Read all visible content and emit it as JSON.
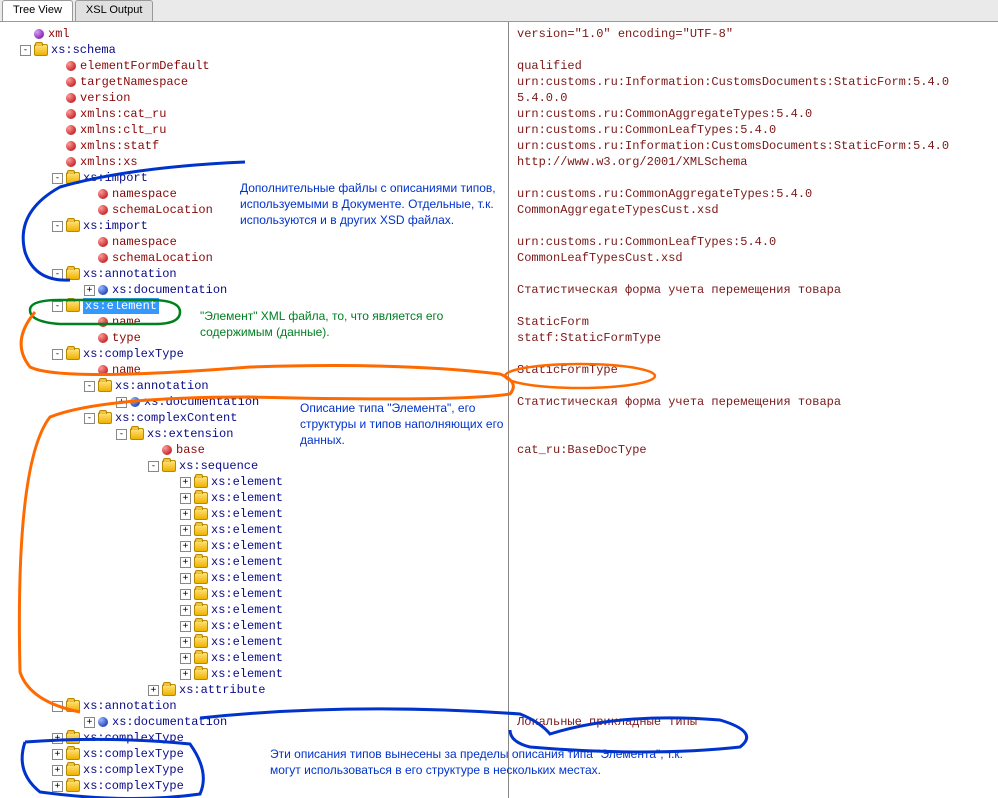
{
  "tabs": {
    "tree_view": "Tree View",
    "xsl_output": "XSL Output"
  },
  "tree": [
    {
      "depth": 0,
      "exp": "",
      "icon": "ball-p",
      "label": "xml",
      "cls": "lbl-red",
      "val": "version=\"1.0\" encoding=\"UTF-8\""
    },
    {
      "depth": 0,
      "exp": "-",
      "icon": "folder",
      "label": "xs:schema",
      "cls": "lbl",
      "val": ""
    },
    {
      "depth": 1,
      "exp": "",
      "icon": "ball-r",
      "label": "elementFormDefault",
      "cls": "lbl-red",
      "val": "qualified"
    },
    {
      "depth": 1,
      "exp": "",
      "icon": "ball-r",
      "label": "targetNamespace",
      "cls": "lbl-red",
      "val": "urn:customs.ru:Information:CustomsDocuments:StaticForm:5.4.0"
    },
    {
      "depth": 1,
      "exp": "",
      "icon": "ball-r",
      "label": "version",
      "cls": "lbl-red",
      "val": "5.4.0.0"
    },
    {
      "depth": 1,
      "exp": "",
      "icon": "ball-r",
      "label": "xmlns:cat_ru",
      "cls": "lbl-red",
      "val": "urn:customs.ru:CommonAggregateTypes:5.4.0"
    },
    {
      "depth": 1,
      "exp": "",
      "icon": "ball-r",
      "label": "xmlns:clt_ru",
      "cls": "lbl-red",
      "val": "urn:customs.ru:CommonLeafTypes:5.4.0"
    },
    {
      "depth": 1,
      "exp": "",
      "icon": "ball-r",
      "label": "xmlns:statf",
      "cls": "lbl-red",
      "val": "urn:customs.ru:Information:CustomsDocuments:StaticForm:5.4.0"
    },
    {
      "depth": 1,
      "exp": "",
      "icon": "ball-r",
      "label": "xmlns:xs",
      "cls": "lbl-red",
      "val": "http://www.w3.org/2001/XMLSchema"
    },
    {
      "depth": 1,
      "exp": "-",
      "icon": "folder",
      "label": "xs:import",
      "cls": "lbl",
      "val": ""
    },
    {
      "depth": 2,
      "exp": "",
      "icon": "ball-r",
      "label": "namespace",
      "cls": "lbl-red",
      "val": "urn:customs.ru:CommonAggregateTypes:5.4.0"
    },
    {
      "depth": 2,
      "exp": "",
      "icon": "ball-r",
      "label": "schemaLocation",
      "cls": "lbl-red",
      "val": "CommonAggregateTypesCust.xsd"
    },
    {
      "depth": 1,
      "exp": "-",
      "icon": "folder",
      "label": "xs:import",
      "cls": "lbl",
      "val": ""
    },
    {
      "depth": 2,
      "exp": "",
      "icon": "ball-r",
      "label": "namespace",
      "cls": "lbl-red",
      "val": "urn:customs.ru:CommonLeafTypes:5.4.0"
    },
    {
      "depth": 2,
      "exp": "",
      "icon": "ball-r",
      "label": "schemaLocation",
      "cls": "lbl-red",
      "val": "CommonLeafTypesCust.xsd"
    },
    {
      "depth": 1,
      "exp": "-",
      "icon": "folder",
      "label": "xs:annotation",
      "cls": "lbl",
      "val": ""
    },
    {
      "depth": 2,
      "exp": "+",
      "icon": "ball-b",
      "label": "xs:documentation",
      "cls": "lbl",
      "val": "Статистическая форма учета перемещения товара"
    },
    {
      "depth": 1,
      "exp": "-",
      "icon": "folder",
      "label": "xs:element",
      "cls": "lbl",
      "val": "",
      "selected": true
    },
    {
      "depth": 2,
      "exp": "",
      "icon": "ball-r",
      "label": "name",
      "cls": "lbl-red",
      "val": "StaticForm"
    },
    {
      "depth": 2,
      "exp": "",
      "icon": "ball-r",
      "label": "type",
      "cls": "lbl-red",
      "val": "statf:StaticFormType"
    },
    {
      "depth": 1,
      "exp": "-",
      "icon": "folder",
      "label": "xs:complexType",
      "cls": "lbl",
      "val": ""
    },
    {
      "depth": 2,
      "exp": "",
      "icon": "ball-r",
      "label": "name",
      "cls": "lbl-red",
      "val": "StaticFormType"
    },
    {
      "depth": 2,
      "exp": "-",
      "icon": "folder",
      "label": "xs:annotation",
      "cls": "lbl",
      "val": ""
    },
    {
      "depth": 3,
      "exp": "+",
      "icon": "ball-b",
      "label": "xs:documentation",
      "cls": "lbl",
      "val": "Статистическая форма учета перемещения товара"
    },
    {
      "depth": 2,
      "exp": "-",
      "icon": "folder",
      "label": "xs:complexContent",
      "cls": "lbl",
      "val": ""
    },
    {
      "depth": 3,
      "exp": "-",
      "icon": "folder",
      "label": "xs:extension",
      "cls": "lbl",
      "val": ""
    },
    {
      "depth": 4,
      "exp": "",
      "icon": "ball-r",
      "label": "base",
      "cls": "lbl-red",
      "val": "cat_ru:BaseDocType"
    },
    {
      "depth": 4,
      "exp": "-",
      "icon": "folder",
      "label": "xs:sequence",
      "cls": "lbl",
      "val": ""
    },
    {
      "depth": 5,
      "exp": "+",
      "icon": "folder",
      "label": "xs:element",
      "cls": "lbl",
      "val": ""
    },
    {
      "depth": 5,
      "exp": "+",
      "icon": "folder",
      "label": "xs:element",
      "cls": "lbl",
      "val": ""
    },
    {
      "depth": 5,
      "exp": "+",
      "icon": "folder",
      "label": "xs:element",
      "cls": "lbl",
      "val": ""
    },
    {
      "depth": 5,
      "exp": "+",
      "icon": "folder",
      "label": "xs:element",
      "cls": "lbl",
      "val": ""
    },
    {
      "depth": 5,
      "exp": "+",
      "icon": "folder",
      "label": "xs:element",
      "cls": "lbl",
      "val": ""
    },
    {
      "depth": 5,
      "exp": "+",
      "icon": "folder",
      "label": "xs:element",
      "cls": "lbl",
      "val": ""
    },
    {
      "depth": 5,
      "exp": "+",
      "icon": "folder",
      "label": "xs:element",
      "cls": "lbl",
      "val": ""
    },
    {
      "depth": 5,
      "exp": "+",
      "icon": "folder",
      "label": "xs:element",
      "cls": "lbl",
      "val": ""
    },
    {
      "depth": 5,
      "exp": "+",
      "icon": "folder",
      "label": "xs:element",
      "cls": "lbl",
      "val": ""
    },
    {
      "depth": 5,
      "exp": "+",
      "icon": "folder",
      "label": "xs:element",
      "cls": "lbl",
      "val": ""
    },
    {
      "depth": 5,
      "exp": "+",
      "icon": "folder",
      "label": "xs:element",
      "cls": "lbl",
      "val": ""
    },
    {
      "depth": 5,
      "exp": "+",
      "icon": "folder",
      "label": "xs:element",
      "cls": "lbl",
      "val": ""
    },
    {
      "depth": 5,
      "exp": "+",
      "icon": "folder",
      "label": "xs:element",
      "cls": "lbl",
      "val": ""
    },
    {
      "depth": 4,
      "exp": "+",
      "icon": "folder",
      "label": "xs:attribute",
      "cls": "lbl",
      "val": ""
    },
    {
      "depth": 1,
      "exp": "-",
      "icon": "folder",
      "label": "xs:annotation",
      "cls": "lbl",
      "val": ""
    },
    {
      "depth": 2,
      "exp": "+",
      "icon": "ball-b",
      "label": "xs:documentation",
      "cls": "lbl",
      "val": "Локальные прикладные типы"
    },
    {
      "depth": 1,
      "exp": "+",
      "icon": "folder",
      "label": "xs:complexType",
      "cls": "lbl",
      "val": ""
    },
    {
      "depth": 1,
      "exp": "+",
      "icon": "folder",
      "label": "xs:complexType",
      "cls": "lbl",
      "val": ""
    },
    {
      "depth": 1,
      "exp": "+",
      "icon": "folder",
      "label": "xs:complexType",
      "cls": "lbl",
      "val": ""
    },
    {
      "depth": 1,
      "exp": "+",
      "icon": "folder",
      "label": "xs:complexType",
      "cls": "lbl",
      "val": ""
    }
  ],
  "annotations": {
    "a1": "Дополнительные файлы с описаниями типов, используемыми в Документе. Отдельные, т.к. используются и в других XSD файлах.",
    "a2": "\"Элемент\"  XML файла, то, что является его содержимым (данные).",
    "a3": "Описание типа \"Элемента\", его структуры и типов наполняющих его данных.",
    "a4": "Эти описания типов вынесены за пределы описания типа \"Элемента\", т.к. могут использоваться в его структуре в нескольких местах."
  }
}
